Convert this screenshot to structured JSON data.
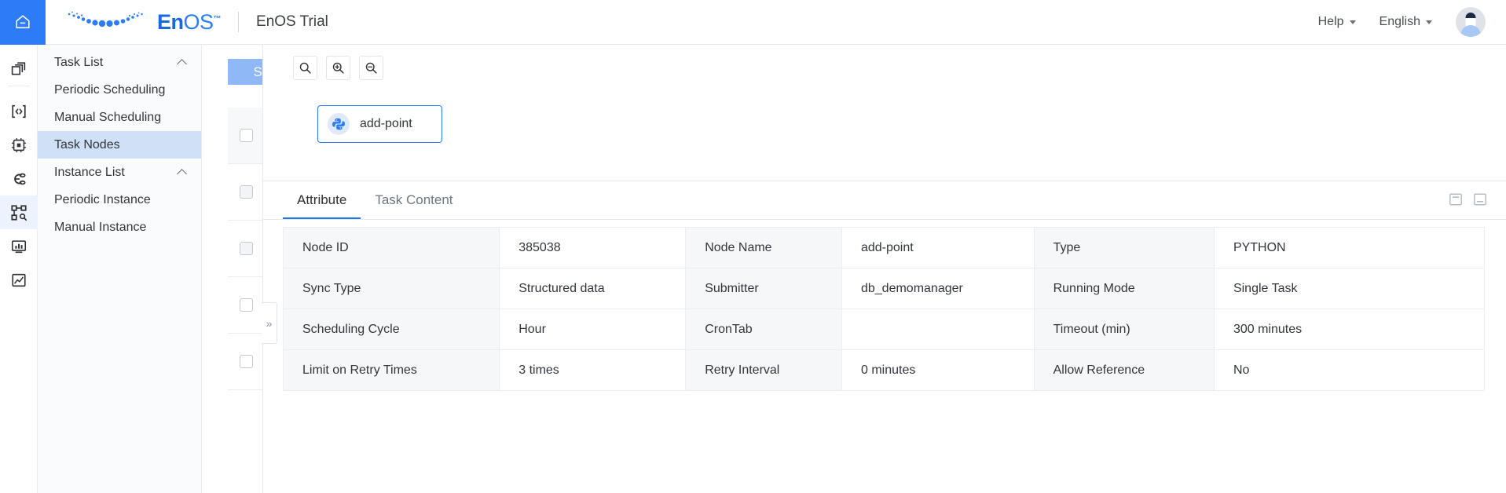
{
  "header": {
    "home_icon": "home-icon",
    "brand_en": "En",
    "brand_os": "OS",
    "brand_tm": "™",
    "app_title": "EnOS Trial",
    "help_label": "Help",
    "language_label": "English",
    "avatar": "user-avatar"
  },
  "icon_rail": [
    {
      "name": "apps-icon"
    },
    {
      "name": "code-icon"
    },
    {
      "name": "device-chip-icon"
    },
    {
      "name": "workflow-icon"
    },
    {
      "name": "task-nodes-icon",
      "active": true
    },
    {
      "name": "dashboard-icon"
    },
    {
      "name": "report-icon"
    }
  ],
  "sidebar": {
    "groups": [
      {
        "label": "Task List",
        "expanded": true,
        "items": [
          {
            "label": "Periodic Scheduling",
            "active": false
          },
          {
            "label": "Manual Scheduling",
            "active": false
          },
          {
            "label": "Task Nodes",
            "active": true
          }
        ]
      },
      {
        "label": "Instance List",
        "expanded": true,
        "items": [
          {
            "label": "Periodic Instance",
            "active": false
          },
          {
            "label": "Manual Instance",
            "active": false
          }
        ]
      }
    ]
  },
  "list_behind": {
    "set_button_label": "Set",
    "rows": [
      {
        "checked": false,
        "shaded": true
      },
      {
        "checked": false,
        "shaded": false
      },
      {
        "checked": false,
        "shaded": false
      },
      {
        "checked": false,
        "shaded": false
      },
      {
        "checked": false,
        "shaded": false
      }
    ]
  },
  "canvas": {
    "toolbar": [
      {
        "name": "search-icon",
        "label": "Search"
      },
      {
        "name": "zoom-in-icon",
        "label": "Zoom In"
      },
      {
        "name": "zoom-out-icon",
        "label": "Zoom Out"
      }
    ],
    "node": {
      "icon": "python-icon",
      "label": "add-point"
    },
    "expand_handle": "»"
  },
  "detail": {
    "tabs": [
      {
        "label": "Attribute",
        "active": true
      },
      {
        "label": "Task Content",
        "active": false
      }
    ],
    "panel_icons": [
      {
        "name": "panel-top-layout-icon"
      },
      {
        "name": "panel-bottom-layout-icon"
      }
    ],
    "attributes": [
      [
        {
          "k": "Node ID",
          "v": "385038"
        },
        {
          "k": "Node Name",
          "v": "add-point"
        },
        {
          "k": "Type",
          "v": "PYTHON"
        }
      ],
      [
        {
          "k": "Sync Type",
          "v": "Structured data"
        },
        {
          "k": "Submitter",
          "v": "db_demomanager"
        },
        {
          "k": "Running Mode",
          "v": "Single Task"
        }
      ],
      [
        {
          "k": "Scheduling Cycle",
          "v": "Hour"
        },
        {
          "k": "CronTab",
          "v": ""
        },
        {
          "k": "Timeout (min)",
          "v": "300 minutes"
        }
      ],
      [
        {
          "k": "Limit on Retry Times",
          "v": "3 times"
        },
        {
          "k": "Retry Interval",
          "v": "0 minutes"
        },
        {
          "k": "Allow Reference",
          "v": "No"
        }
      ]
    ]
  },
  "colors": {
    "accent": "#2b7cf6",
    "tab_underline": "#1a73e8",
    "nav_active_bg": "#cfe0f7",
    "set_button_bg": "#8fb9f6"
  }
}
